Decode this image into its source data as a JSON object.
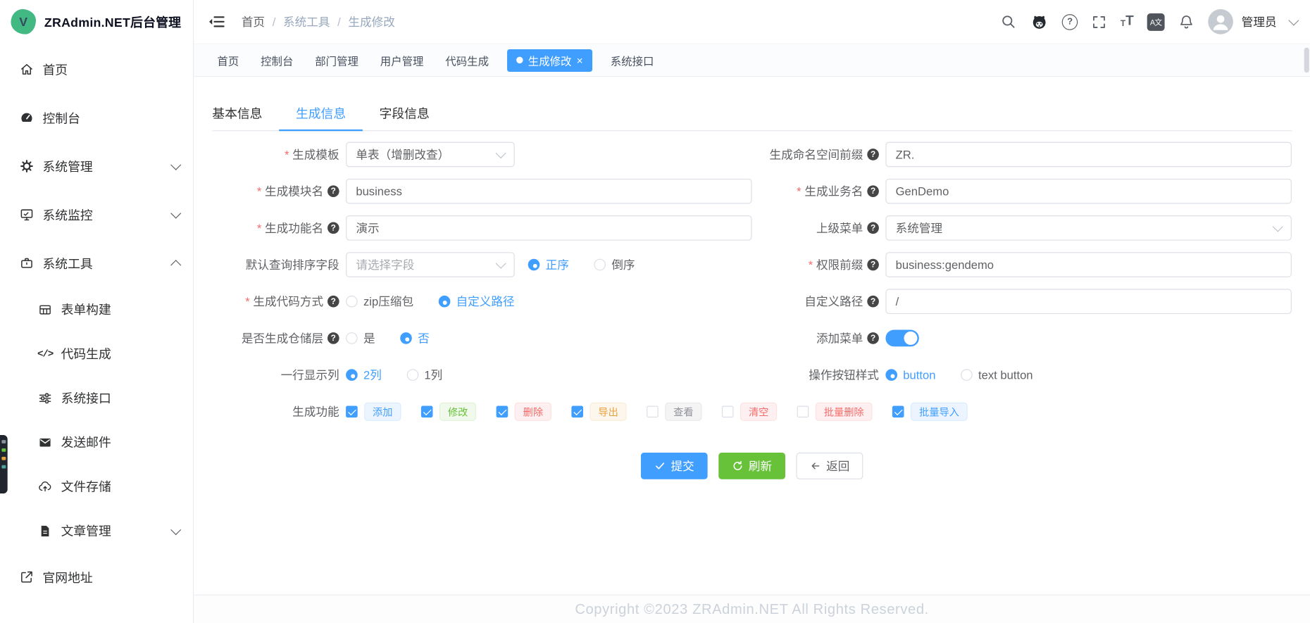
{
  "colors": {
    "primary": "#409eff",
    "success": "#67c23a",
    "danger": "#f56c6c",
    "warning": "#e6a23c",
    "info": "#909399",
    "logo_green": "#42b983"
  },
  "glyphs": {
    "required": "*",
    "help": "?",
    "close": "×",
    "lang": "A文",
    "code": "</>",
    "font_small": "T",
    "font_big": "T"
  },
  "app": {
    "title": "ZRAdmin.NET后台管理",
    "logo_letter": "V"
  },
  "breadcrumb": {
    "sep": "/",
    "items": [
      {
        "label": "首页"
      },
      {
        "label": "系统工具"
      },
      {
        "label": "生成修改"
      }
    ]
  },
  "header": {
    "user": "管理员",
    "icons": [
      "search-icon",
      "github-icon",
      "help-icon",
      "fullscreen-icon",
      "font-size-icon",
      "language-icon",
      "bell-icon"
    ]
  },
  "sidebar": {
    "items": [
      {
        "label": "首页",
        "icon": "home-icon"
      },
      {
        "label": "控制台",
        "icon": "dashboard-icon"
      },
      {
        "label": "系统管理",
        "icon": "gear-icon",
        "expandable": true,
        "expanded": false
      },
      {
        "label": "系统监控",
        "icon": "monitor-icon",
        "expandable": true,
        "expanded": false
      },
      {
        "label": "系统工具",
        "icon": "briefcase-icon",
        "expandable": true,
        "expanded": true
      },
      {
        "label": "表单构建",
        "icon": "form-icon",
        "sub": true
      },
      {
        "label": "代码生成",
        "icon": "code-icon",
        "sub": true
      },
      {
        "label": "系统接口",
        "icon": "sliders-icon",
        "sub": true
      },
      {
        "label": "发送邮件",
        "icon": "envelope-icon",
        "sub": true
      },
      {
        "label": "文件存储",
        "icon": "cloud-upload-icon",
        "sub": true
      },
      {
        "label": "文章管理",
        "icon": "document-icon",
        "sub": true,
        "expandable": true,
        "expanded": false
      },
      {
        "label": "官网地址",
        "icon": "external-link-icon"
      }
    ]
  },
  "tags_view": {
    "tabs": [
      {
        "label": "首页",
        "active": false
      },
      {
        "label": "控制台",
        "active": false
      },
      {
        "label": "部门管理",
        "active": false
      },
      {
        "label": "用户管理",
        "active": false
      },
      {
        "label": "代码生成",
        "active": false
      },
      {
        "label": "生成修改",
        "active": true,
        "closable": true
      },
      {
        "label": "系统接口",
        "active": false
      }
    ]
  },
  "page_tabs": {
    "items": [
      {
        "label": "基本信息",
        "active": false
      },
      {
        "label": "生成信息",
        "active": true
      },
      {
        "label": "字段信息",
        "active": false
      }
    ]
  },
  "form": {
    "rows": {
      "template": {
        "label": "生成模板",
        "required": true,
        "value": "单表（增删改查）"
      },
      "namespace": {
        "label": "生成命名空间前缀",
        "help": true,
        "value": "ZR."
      },
      "module": {
        "label": "生成模块名",
        "required": true,
        "help": true,
        "value": "business"
      },
      "business": {
        "label": "生成业务名",
        "required": true,
        "help": true,
        "value": "GenDemo"
      },
      "func": {
        "label": "生成功能名",
        "required": true,
        "help": true,
        "value": "演示"
      },
      "parent_menu": {
        "label": "上级菜单",
        "help": true,
        "value": "系统管理"
      },
      "sort": {
        "label": "默认查询排序字段",
        "placeholder": "请选择字段",
        "asc": "正序",
        "desc": "倒序",
        "selected": "正序"
      },
      "perm": {
        "label": "权限前缀",
        "required": true,
        "help": true,
        "value": "business:gendemo"
      },
      "code_mode": {
        "label": "生成代码方式",
        "required": true,
        "help": true,
        "zip": "zip压缩包",
        "custom": "自定义路径",
        "selected": "自定义路径"
      },
      "custom_path": {
        "label": "自定义路径",
        "help": true,
        "value": "/"
      },
      "repo": {
        "label": "是否生成仓储层",
        "help": true,
        "yes": "是",
        "no": "否",
        "selected": "否"
      },
      "add_menu": {
        "label": "添加菜单",
        "help": true,
        "on": true
      },
      "columns": {
        "label": "一行显示列",
        "two": "2列",
        "one": "1列",
        "selected": "2列"
      },
      "btn_style": {
        "label": "操作按钮样式",
        "button": "button",
        "text": "text button",
        "selected": "button"
      },
      "features": {
        "label": "生成功能",
        "items": [
          {
            "label": "添加",
            "checked": true,
            "variant": "primary"
          },
          {
            "label": "修改",
            "checked": true,
            "variant": "success"
          },
          {
            "label": "删除",
            "checked": true,
            "variant": "danger"
          },
          {
            "label": "导出",
            "checked": true,
            "variant": "warning"
          },
          {
            "label": "查看",
            "checked": false,
            "variant": "info"
          },
          {
            "label": "清空",
            "checked": false,
            "variant": "danger"
          },
          {
            "label": "批量删除",
            "checked": false,
            "variant": "danger"
          },
          {
            "label": "批量导入",
            "checked": true,
            "variant": "primary"
          }
        ]
      }
    }
  },
  "actions": {
    "submit": "提交",
    "refresh": "刷新",
    "back": "返回"
  },
  "footer": {
    "copyright": "Copyright ©2023 ZRAdmin.NET All Rights Reserved."
  }
}
